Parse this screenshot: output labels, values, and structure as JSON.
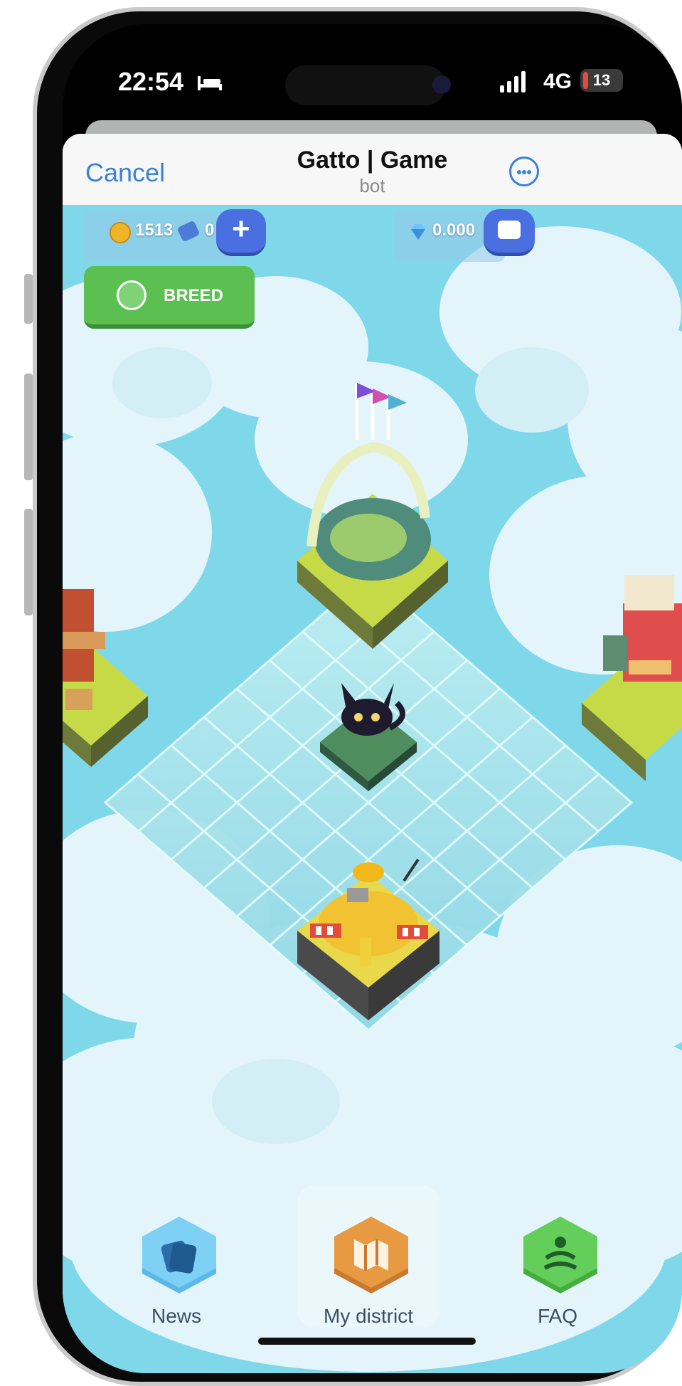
{
  "status_bar": {
    "time": "22:54",
    "network": "4G",
    "battery": "13",
    "battery_level": 0.13
  },
  "header": {
    "cancel_label": "Cancel",
    "title": "Gatto | Game",
    "subtitle": "bot"
  },
  "hud": {
    "coins": "1513",
    "tickets": "0",
    "gems": "0.000",
    "breed_label": "BREED"
  },
  "bottom_nav": [
    {
      "label": "News",
      "color": "#5ab8ea",
      "icon": "cards-icon"
    },
    {
      "label": "My district",
      "color": "#e89a42",
      "icon": "map-icon",
      "active": true
    },
    {
      "label": "FAQ",
      "color": "#63cf5a",
      "icon": "meditation-icon"
    }
  ],
  "colors": {
    "accent": "#3b82d6",
    "sky": "#7fd8ea",
    "breed": "#5cbf52",
    "plus": "#4a6fe0"
  }
}
